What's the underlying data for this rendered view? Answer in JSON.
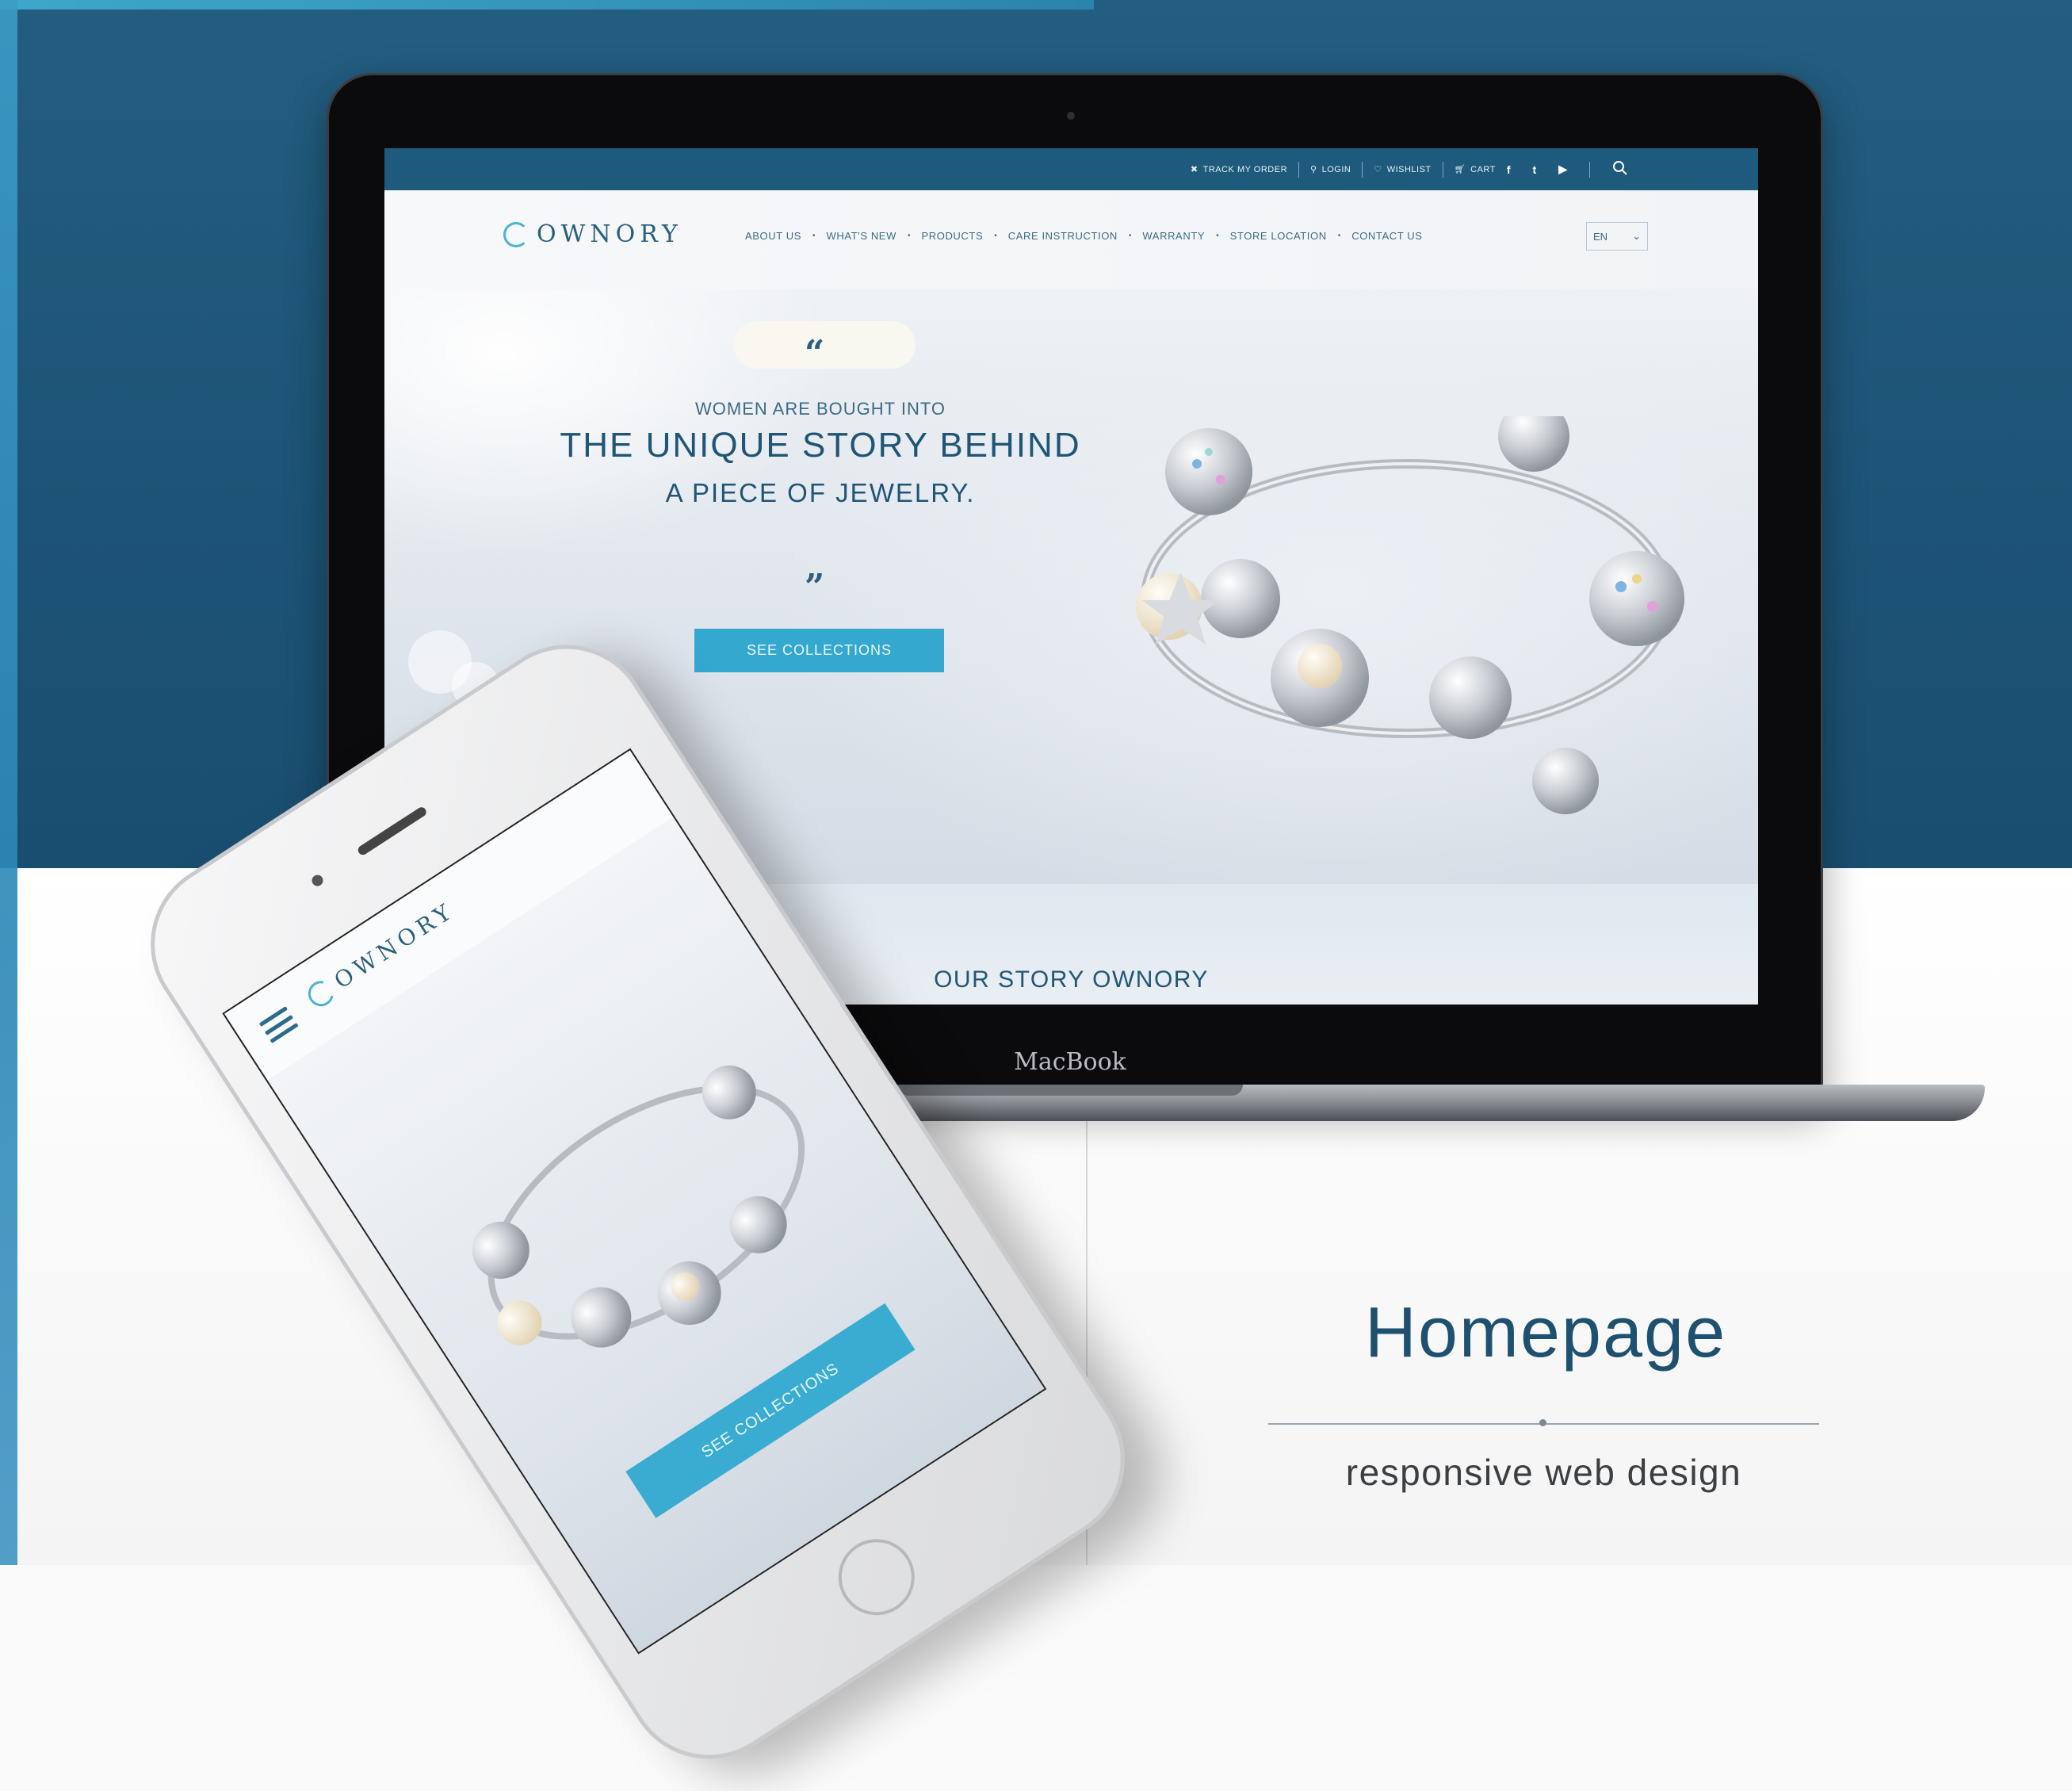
{
  "site": {
    "topbar": {
      "track_order": "TRACK MY ORDER",
      "login": "LOGIN",
      "wishlist": "WISHLIST",
      "cart": "CART"
    },
    "brand": "OWNORY",
    "nav": [
      "ABOUT US",
      "WHAT'S NEW",
      "PRODUCTS",
      "CARE INSTRUCTION",
      "WARRANTY",
      "STORE LOCATION",
      "CONTACT US"
    ],
    "language": "EN",
    "hero": {
      "open_quote": "“",
      "kicker": "WOMEN ARE BOUGHT INTO",
      "title": "THE UNIQUE STORY BEHIND",
      "subtitle": "A PIECE OF JEWELRY.",
      "close_quote": "”",
      "cta": "SEE COLLECTIONS"
    },
    "story_title": "OUR STORY OWNORY"
  },
  "device": {
    "laptop_label": "MacBook"
  },
  "mobile": {
    "brand": "OWNORY",
    "cta": "SEE COLLECTIONS"
  },
  "caption": {
    "title": "Homepage",
    "subtitle": "responsive web design"
  },
  "colors": {
    "brand_dark": "#1e5a7c",
    "accent": "#35a8cf",
    "text": "#1f5576"
  },
  "icons": [
    "truck-icon",
    "user-icon",
    "heart-icon",
    "cart-icon",
    "facebook-icon",
    "twitter-icon",
    "youtube-icon",
    "search-icon",
    "chevron-down-icon",
    "menu-icon"
  ]
}
